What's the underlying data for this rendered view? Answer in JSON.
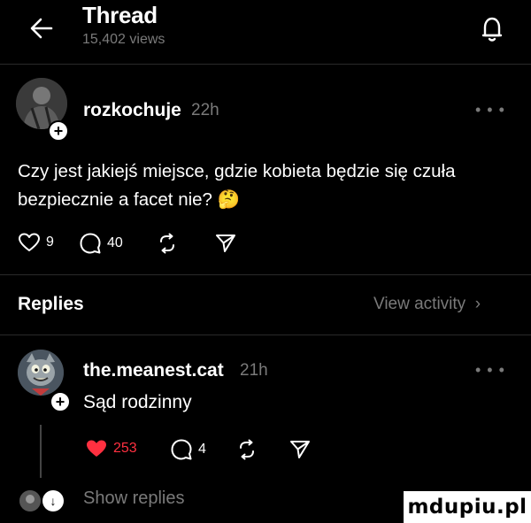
{
  "header": {
    "title": "Thread",
    "views": "15,402 views"
  },
  "post": {
    "username": "rozkochuje",
    "time": "22h",
    "text": "Czy jest jakiejś miejsce, gdzie kobieta będzie się czuła bezpiecznie a facet nie? 🤔",
    "likes": "9",
    "comments": "40"
  },
  "replies_section": {
    "label": "Replies",
    "view_activity": "View activity"
  },
  "reply": {
    "username": "the.meanest.cat",
    "time": "21h",
    "text": "Sąd rodzinny",
    "likes": "253",
    "comments": "4",
    "like_color": "#ff3040"
  },
  "show_replies": "Show replies",
  "watermark": "mdupiu.pl"
}
